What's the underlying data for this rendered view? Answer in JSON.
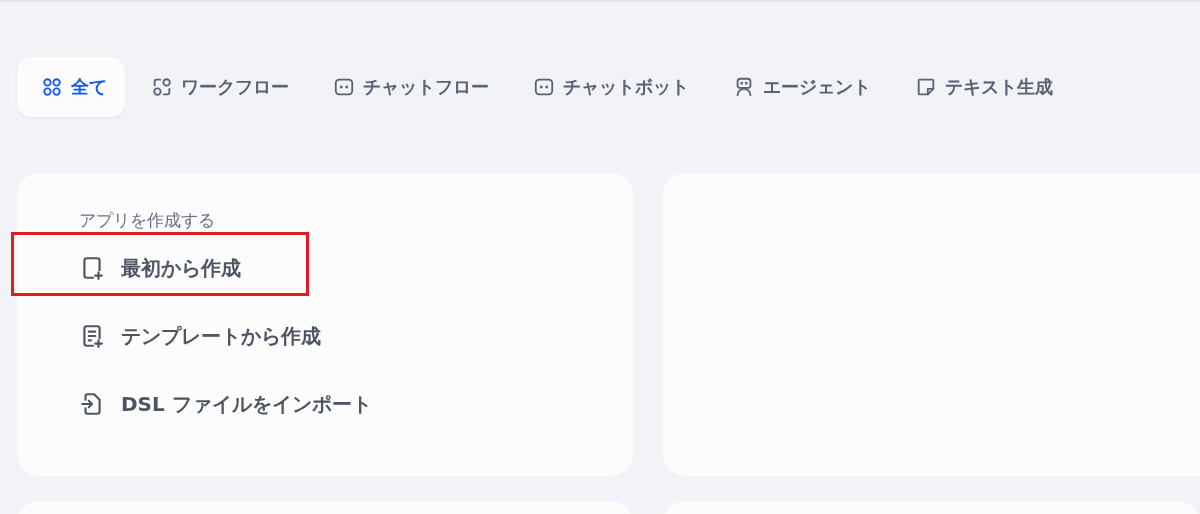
{
  "tabs": [
    {
      "label": "全て",
      "kind": "grid",
      "selected": true
    },
    {
      "label": "ワークフロー",
      "kind": "workflow",
      "selected": false
    },
    {
      "label": "チャットフロー",
      "kind": "chat",
      "selected": false
    },
    {
      "label": "チャットボット",
      "kind": "chat",
      "selected": false
    },
    {
      "label": "エージェント",
      "kind": "robot",
      "selected": false
    },
    {
      "label": "テキスト生成",
      "kind": "note",
      "selected": false
    }
  ],
  "create_card": {
    "heading": "アプリを作成する",
    "items": [
      {
        "label": "最初から作成",
        "kind": "blank",
        "highlighted": true
      },
      {
        "label": "テンプレートから作成",
        "kind": "template",
        "highlighted": false
      },
      {
        "label": "DSL ファイルをインポート",
        "kind": "import",
        "highlighted": false
      }
    ]
  }
}
